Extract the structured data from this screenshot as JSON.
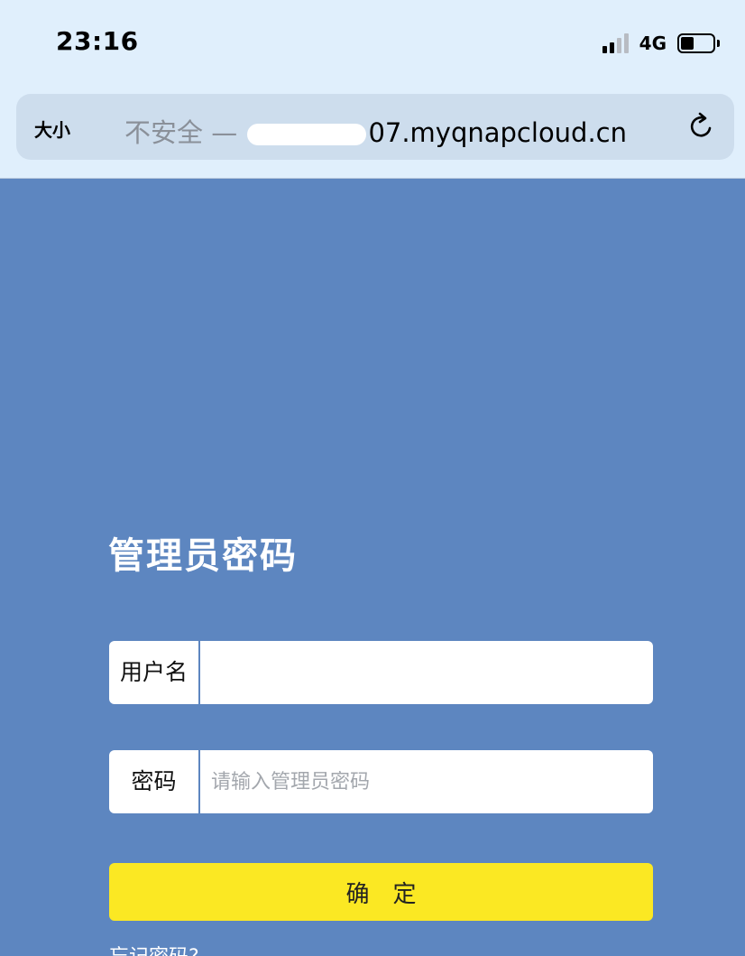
{
  "status_bar": {
    "time": "23:16",
    "network": "4G",
    "signal_bars_active": 2,
    "signal_bars_total": 4,
    "battery_level": 0.4
  },
  "address_bar": {
    "text_size_label": "大小",
    "insecure_label": "不安全 —",
    "url_visible_suffix": "07.myqnapcloud.cn",
    "reload_icon": "reload-icon"
  },
  "login": {
    "title": "管理员密码",
    "username_label": "用户名",
    "username_value": "",
    "password_label": "密码",
    "password_placeholder": "请输入管理员密码",
    "confirm_label": "确定",
    "forgot_label": "忘记密码?"
  },
  "colors": {
    "background": "#5d86c0",
    "browser_chrome": "#e0effc",
    "address_bar": "#cddded",
    "button": "#fbe823"
  }
}
